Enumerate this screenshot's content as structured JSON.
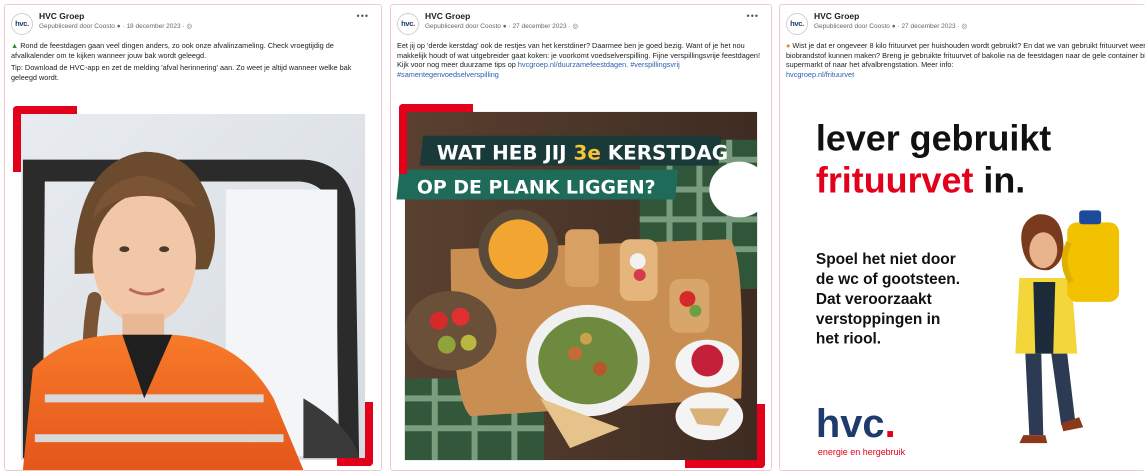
{
  "posts": [
    {
      "logo_text": "hvc",
      "logo_dot": ".",
      "page_name": "HVC Groep",
      "meta": "Gepubliceerd door Coosto",
      "date": "18 december 2023",
      "more_icon": "ellipsis-icon",
      "body": [
        "Rond de feestdagen gaan veel dingen anders, zo ook onze afvalinzameling. Check vroegtijdig de afvalkalender om te kijken wanneer jouw bak wordt geleegd.",
        "Tip: Download de HVC-app en zet de melding 'afval herinnering' aan. Zo weet je altijd wanneer welke bak geleegd wordt."
      ],
      "lead_icon": "christmas-tree-icon"
    },
    {
      "logo_text": "hvc",
      "logo_dot": ".",
      "page_name": "HVC Groep",
      "meta": "Gepubliceerd door Coosto",
      "date": "27 december 2023",
      "more_icon": "ellipsis-icon",
      "body_text": "Eet jij op 'derde kerstdag' ook de restjes van het kerstdiner? Daarmee ben je goed bezig. Want of je het nou makkelijk houdt of wat uitgebreider gaat koken: je voorkomt voedselverspilling. Fijne verspillingsvrije feestdagen! Kijk voor nog meer duurzame tips op",
      "link": "hvcgroep.nl/duurzamefeestdagen.",
      "tags": [
        "#verspillingsvrij",
        "#samentegenvoedselverspilling"
      ],
      "image": {
        "headline_1a": "WAT HEB JIJ ",
        "headline_1b": "3e",
        "headline_1c": " KERSTDAG",
        "headline_2": "OP DE PLANK LIGGEN?"
      }
    },
    {
      "logo_text": "hvc",
      "logo_dot": ".",
      "page_name": "HVC Groep",
      "meta": "Gepubliceerd door Coosto",
      "date": "27 december 2023",
      "more_icon": "ellipsis-icon",
      "body_text": "Wist je dat er ongeveer 8 kilo frituurvet per huishouden wordt gebruikt? En dat we van gebruikt frituurvet weer biobrandstof kunnen maken? Breng je gebruikte frituurvet of bakolie na de feestdagen naar de gele container bij de supermarkt of naar het afvalbrengstation. Meer info:",
      "link": "hvcgroep.nl/frituurvet",
      "lead_icon": "fries-icon",
      "image": {
        "headline_black_1": "lever gebruikt",
        "headline_red": "frituurvet",
        "headline_black_2": " in.",
        "subtext": [
          "Spoel het niet door",
          "de wc of gootsteen.",
          "Dat veroorzaakt",
          "verstoppingen in",
          "het riool."
        ],
        "brand_logo": "hvc",
        "brand_dot": ".",
        "brand_tagline": "energie en hergebruik"
      }
    }
  ],
  "colors": {
    "brand_red": "#e3001b",
    "brand_navy": "#1f3a6d",
    "link_blue": "#2a5db0",
    "headline_teal": "#1a3a3a",
    "headline_green": "#1f6b5a",
    "safety_orange": "#f36a20",
    "oil_yellow": "#f2c100"
  }
}
